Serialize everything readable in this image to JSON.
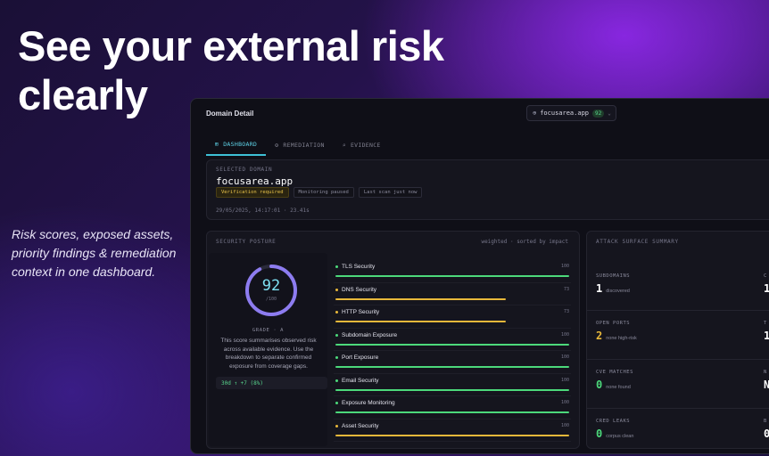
{
  "hero": {
    "title": "See your external risk clearly",
    "subtitle": "Risk scores, exposed assets, priority findings & remediation context in one dashboard."
  },
  "window": {
    "title": "Domain Detail",
    "domain_select": {
      "value": "focusarea.app",
      "score": "92",
      "icon": "globe-icon"
    }
  },
  "tabs": [
    {
      "label": "DASHBOARD",
      "icon": "grid-icon",
      "active": true
    },
    {
      "label": "REMEDIATION",
      "icon": "wrench-icon",
      "active": false
    },
    {
      "label": "EVIDENCE",
      "icon": "magnifier-icon",
      "active": false
    }
  ],
  "selected": {
    "label": "SELECTED DOMAIN",
    "domain": "focusarea.app",
    "badges": [
      "Verification required",
      "Monitoring paused",
      "Last scan just now"
    ],
    "timestamp": "29/05/2025, 14:17:01 · 23.41s"
  },
  "posture": {
    "title": "SECURITY POSTURE",
    "meta": "weighted · sorted by impact",
    "score": "92",
    "score_max": "/100",
    "score_fraction": 0.92,
    "grade": "GRADE · A",
    "description": "This score summarises observed risk across available evidence. Use the breakdown to separate confirmed exposure from coverage gaps.",
    "trend": "30d ↑ +7 (8%)",
    "metrics": [
      {
        "name": "TLS Security",
        "value": "100",
        "level": 1.0,
        "color": "#4cd97b"
      },
      {
        "name": "DNS Security",
        "value": "73",
        "level": 0.73,
        "color": "#e8b83a"
      },
      {
        "name": "HTTP Security",
        "value": "73",
        "level": 0.73,
        "color": "#e8b83a"
      },
      {
        "name": "Subdomain Exposure",
        "value": "100",
        "level": 1.0,
        "color": "#4cd97b"
      },
      {
        "name": "Port Exposure",
        "value": "100",
        "level": 1.0,
        "color": "#4cd97b"
      },
      {
        "name": "Email Security",
        "value": "100",
        "level": 1.0,
        "color": "#4cd97b"
      },
      {
        "name": "Exposure Monitoring",
        "value": "100",
        "level": 1.0,
        "color": "#4cd97b"
      },
      {
        "name": "Asset Security",
        "value": "100",
        "level": 1.0,
        "color": "#e8b83a"
      }
    ]
  },
  "attack": {
    "title": "ATTACK SURFACE SUMMARY",
    "cells": [
      {
        "label": "SUBDOMAINS",
        "value": "1",
        "note": "discovered",
        "color": "#ffffff"
      },
      {
        "label": "C",
        "value": "1",
        "note": "",
        "color": "#ffffff"
      },
      {
        "label": "OPEN PORTS",
        "value": "2",
        "note": "none high-risk",
        "color": "#e8b83a"
      },
      {
        "label": "T",
        "value": "1",
        "note": "",
        "color": "#ffffff"
      },
      {
        "label": "CVE MATCHES",
        "value": "0",
        "note": "none found",
        "color": "#4cd97b"
      },
      {
        "label": "N",
        "value": "N",
        "note": "",
        "color": "#ffffff"
      },
      {
        "label": "CRED LEAKS",
        "value": "0",
        "note": "corpus clean",
        "color": "#4cd97b"
      },
      {
        "label": "B",
        "value": "0",
        "note": "",
        "color": "#ffffff"
      }
    ]
  }
}
